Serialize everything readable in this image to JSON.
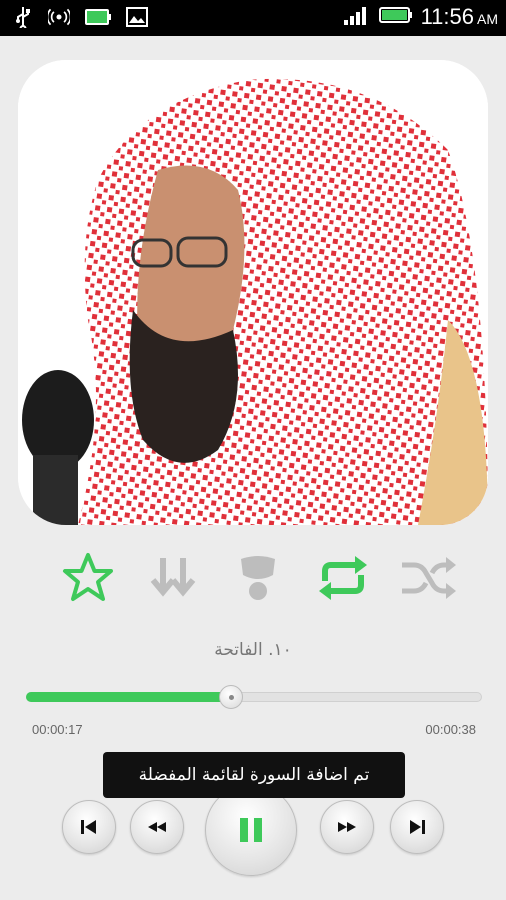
{
  "status_bar": {
    "time": "11:56",
    "ampm": "AM",
    "battery_level": "100",
    "icons": [
      "usb-icon",
      "wifi-hotspot-icon",
      "battery-icon",
      "image-icon",
      "signal-icon"
    ]
  },
  "cover": {
    "icon": "reciter-photo"
  },
  "controls": {
    "favorite_icon": "star-icon",
    "download_icon": "download-arrows-icon",
    "share_icon": "share-icon",
    "repeat_icon": "repeat-icon",
    "shuffle_icon": "shuffle-icon",
    "accent_color": "#3ec95a",
    "inactive_color": "#bdbdbd"
  },
  "track": {
    "title": "١٠. الفاتحة"
  },
  "progress": {
    "current": "00:00:17",
    "total": "00:00:38",
    "fraction": 0.45
  },
  "toast": {
    "message": "تم اضافة السورة  لقائمة المفضلة"
  },
  "transport": {
    "prev_icon": "skip-previous-icon",
    "rewind_icon": "rewind-icon",
    "pause_icon": "pause-icon",
    "forward_icon": "fast-forward-icon",
    "next_icon": "skip-next-icon"
  }
}
